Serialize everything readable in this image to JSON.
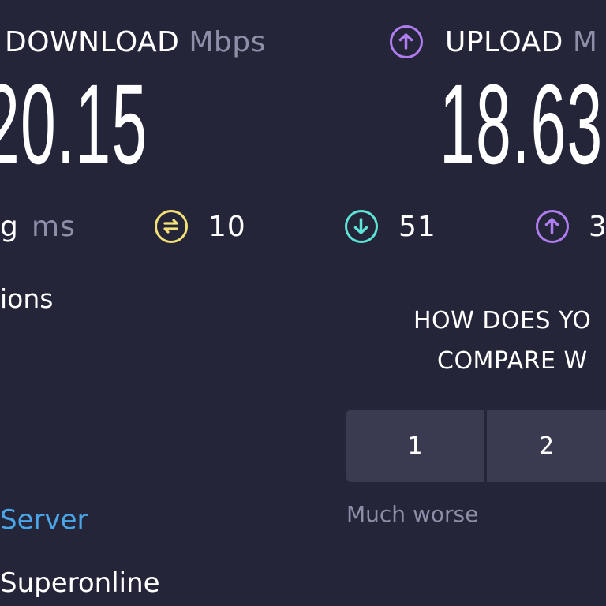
{
  "download": {
    "label": "DOWNLOAD",
    "unit": "Mbps",
    "value": "20.15",
    "icon": "arrow-down-circle-icon",
    "color": "#5ee4d6"
  },
  "upload": {
    "label": "UPLOAD",
    "unit": "M",
    "value": "18.63",
    "icon": "arrow-up-circle-icon",
    "color": "#b07df0"
  },
  "metrics": {
    "ping_label_partial": "g",
    "ping_unit": "ms",
    "jitter": {
      "icon": "jitter-icon",
      "value": "10",
      "color": "#f3e076"
    },
    "download_latency": {
      "icon": "arrow-down-circle-icon",
      "value": "51",
      "color": "#5ee4d6"
    },
    "upload_latency": {
      "icon": "arrow-up-circle-icon",
      "value": "3",
      "color": "#b07df0"
    }
  },
  "left_panel": {
    "section_title_partial": "ions",
    "server_link_partial": "Server",
    "isp_partial": "Superonline"
  },
  "survey": {
    "question_line1": "HOW DOES YO",
    "question_line2": "COMPARE W",
    "options": [
      "1",
      "2"
    ],
    "low_label": "Much worse"
  }
}
